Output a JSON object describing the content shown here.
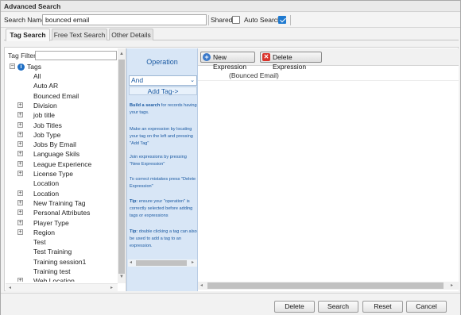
{
  "window": {
    "title": "Advanced Search"
  },
  "search": {
    "name_label": "Search Name",
    "name_value": "bounced email",
    "shared_label": "Shared",
    "shared_checked": false,
    "auto_label": "Auto Search",
    "auto_checked": true
  },
  "tabs": [
    {
      "label": "Tag Search",
      "active": true
    },
    {
      "label": "Free Text Search",
      "active": false
    },
    {
      "label": "Other Details",
      "active": false
    }
  ],
  "tag_pane": {
    "filter_label": "Tag Filter",
    "filter_value": "",
    "root": "Tags",
    "items": [
      {
        "label": "All",
        "expandable": false
      },
      {
        "label": "Auto AR",
        "expandable": false
      },
      {
        "label": "Bounced Email",
        "expandable": false
      },
      {
        "label": "Division",
        "expandable": true
      },
      {
        "label": "job title",
        "expandable": true
      },
      {
        "label": "Job Titles",
        "expandable": true
      },
      {
        "label": "Job Type",
        "expandable": true
      },
      {
        "label": "Jobs By Email",
        "expandable": true
      },
      {
        "label": "Language Skils",
        "expandable": true
      },
      {
        "label": "League Experience",
        "expandable": true
      },
      {
        "label": "License Type",
        "expandable": true
      },
      {
        "label": "Location",
        "expandable": false
      },
      {
        "label": "Location",
        "expandable": true
      },
      {
        "label": "New Training Tag",
        "expandable": true
      },
      {
        "label": "Personal Attributes",
        "expandable": true
      },
      {
        "label": "Player Type",
        "expandable": true
      },
      {
        "label": "Region",
        "expandable": true
      },
      {
        "label": "Test",
        "expandable": false
      },
      {
        "label": "Test Training",
        "expandable": false
      },
      {
        "label": "Training session1",
        "expandable": false
      },
      {
        "label": "Training test",
        "expandable": false
      },
      {
        "label": "Web Location",
        "expandable": true
      }
    ]
  },
  "operation": {
    "title": "Operation",
    "selected": "And",
    "add_tag_label": "Add Tag->",
    "help": [
      {
        "bold": "Build a search",
        "text": " for records having your tags."
      },
      {
        "bold": "",
        "text": "Make an expression by locating your tag on the left and pressing \"Add Tag\""
      },
      {
        "bold": "",
        "text": "Join expressions by pressing \"New Expression\""
      },
      {
        "bold": "",
        "text": "To correct mistakes press \"Delete Expression\""
      },
      {
        "bold": "Tip:",
        "text": " ensure your \"operation\" is correctly selected before adding tags or expressions"
      },
      {
        "bold": "Tip:",
        "text": " double clicking a tag can also be used to add a tag to an expression."
      }
    ]
  },
  "expression": {
    "new_label": "New Expression",
    "delete_label": "Delete Expression",
    "rows": [
      "(Bounced Email)"
    ]
  },
  "footer": {
    "delete": "Delete",
    "search": "Search",
    "reset": "Reset",
    "cancel": "Cancel"
  }
}
